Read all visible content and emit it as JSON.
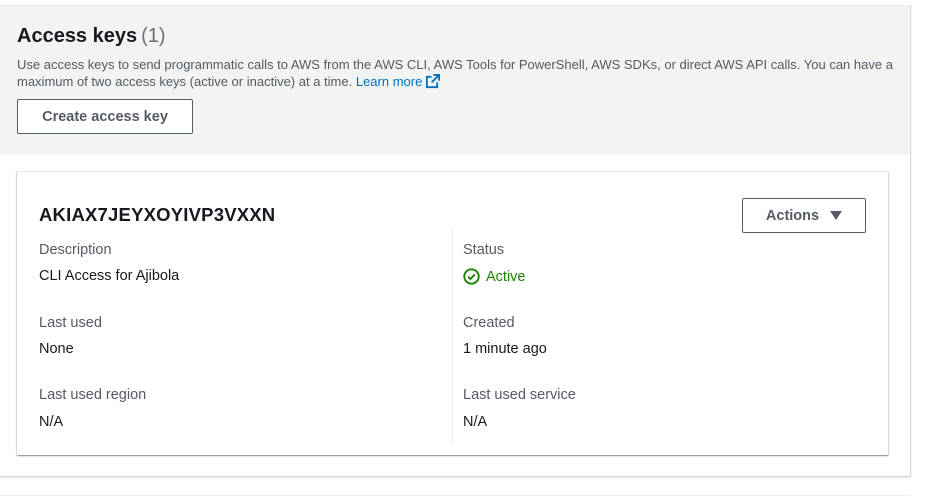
{
  "section": {
    "title": "Access keys",
    "count": "(1)",
    "description": "Use access keys to send programmatic calls to AWS from the AWS CLI, AWS Tools for PowerShell, AWS SDKs, or direct AWS API calls. You can have a maximum of two access keys (active or inactive) at a time.",
    "learn_more": "Learn more",
    "create_button": "Create access key"
  },
  "key": {
    "id": "AKIAX7JEYXOYIVP3VXXN",
    "actions_button": "Actions",
    "fields": {
      "description_label": "Description",
      "description_value": "CLI Access for Ajibola",
      "status_label": "Status",
      "status_value": "Active",
      "last_used_label": "Last used",
      "last_used_value": "None",
      "created_label": "Created",
      "created_value": "1 minute ago",
      "last_used_region_label": "Last used region",
      "last_used_region_value": "N/A",
      "last_used_service_label": "Last used service",
      "last_used_service_value": "N/A"
    }
  },
  "colors": {
    "link": "#0073bb",
    "active": "#1d8102",
    "header_bg": "#f2f3f3"
  }
}
